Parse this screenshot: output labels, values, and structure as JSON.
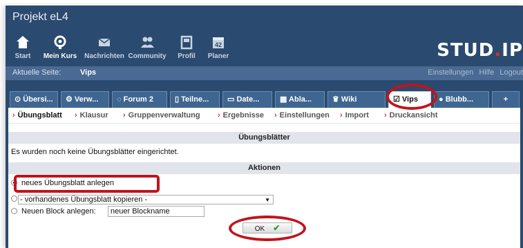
{
  "app_title": "Projekt eL4",
  "nav": {
    "items": [
      {
        "label": "Start",
        "icon": "home-icon"
      },
      {
        "label": "Mein Kurs",
        "icon": "course-icon"
      },
      {
        "label": "Nachrichten",
        "icon": "mail-icon"
      },
      {
        "label": "Community",
        "icon": "community-icon"
      },
      {
        "label": "Profil",
        "icon": "profile-icon"
      },
      {
        "label": "Planer",
        "icon": "calendar-icon"
      }
    ],
    "logo": "STUD",
    "logo_dot": ".",
    "logo_end": "IP"
  },
  "breadcrumb": {
    "label": "Aktuelle Seite:",
    "value": "Vips",
    "links": [
      "Einstellungen",
      "Hilfe",
      "Logout"
    ]
  },
  "tabs": [
    {
      "label": "Übersi...",
      "icon": "overview-icon"
    },
    {
      "label": "Verw...",
      "icon": "admin-icon"
    },
    {
      "label": "Forum 2",
      "icon": "forum-icon"
    },
    {
      "label": "Teilne...",
      "icon": "participants-icon"
    },
    {
      "label": "Date...",
      "icon": "files-icon"
    },
    {
      "label": "Abla...",
      "icon": "schedule-icon"
    },
    {
      "label": "Wiki",
      "icon": "wiki-icon"
    },
    {
      "label": "Vips",
      "icon": "vips-icon"
    },
    {
      "label": "Blubb...",
      "icon": "blubber-icon"
    },
    {
      "label": "+",
      "icon": ""
    }
  ],
  "subnav": [
    "Übungsblatt",
    "Klausur",
    "Gruppenverwaltung",
    "Ergebnisse",
    "Einstellungen",
    "Import",
    "Druckansicht"
  ],
  "sections": {
    "sheets_title": "Übungsblätter",
    "sheets_empty": "Es wurden noch keine Übungsblätter eingerichtet.",
    "actions_title": "Aktionen"
  },
  "actions": {
    "new_sheet": "neues Übungsblatt anlegen",
    "copy_select": "- vorhandenes Übungsblatt kopieren -",
    "new_block_label": "Neuen Block anlegen:",
    "new_block_value": "neuer Blockname",
    "ok_label": "OK"
  },
  "colors": {
    "header_bg": "#2b4a6f",
    "breadcrumb_bg": "#4a6a93",
    "annotation": "#c0141c",
    "accent_red": "#d32f2f"
  }
}
